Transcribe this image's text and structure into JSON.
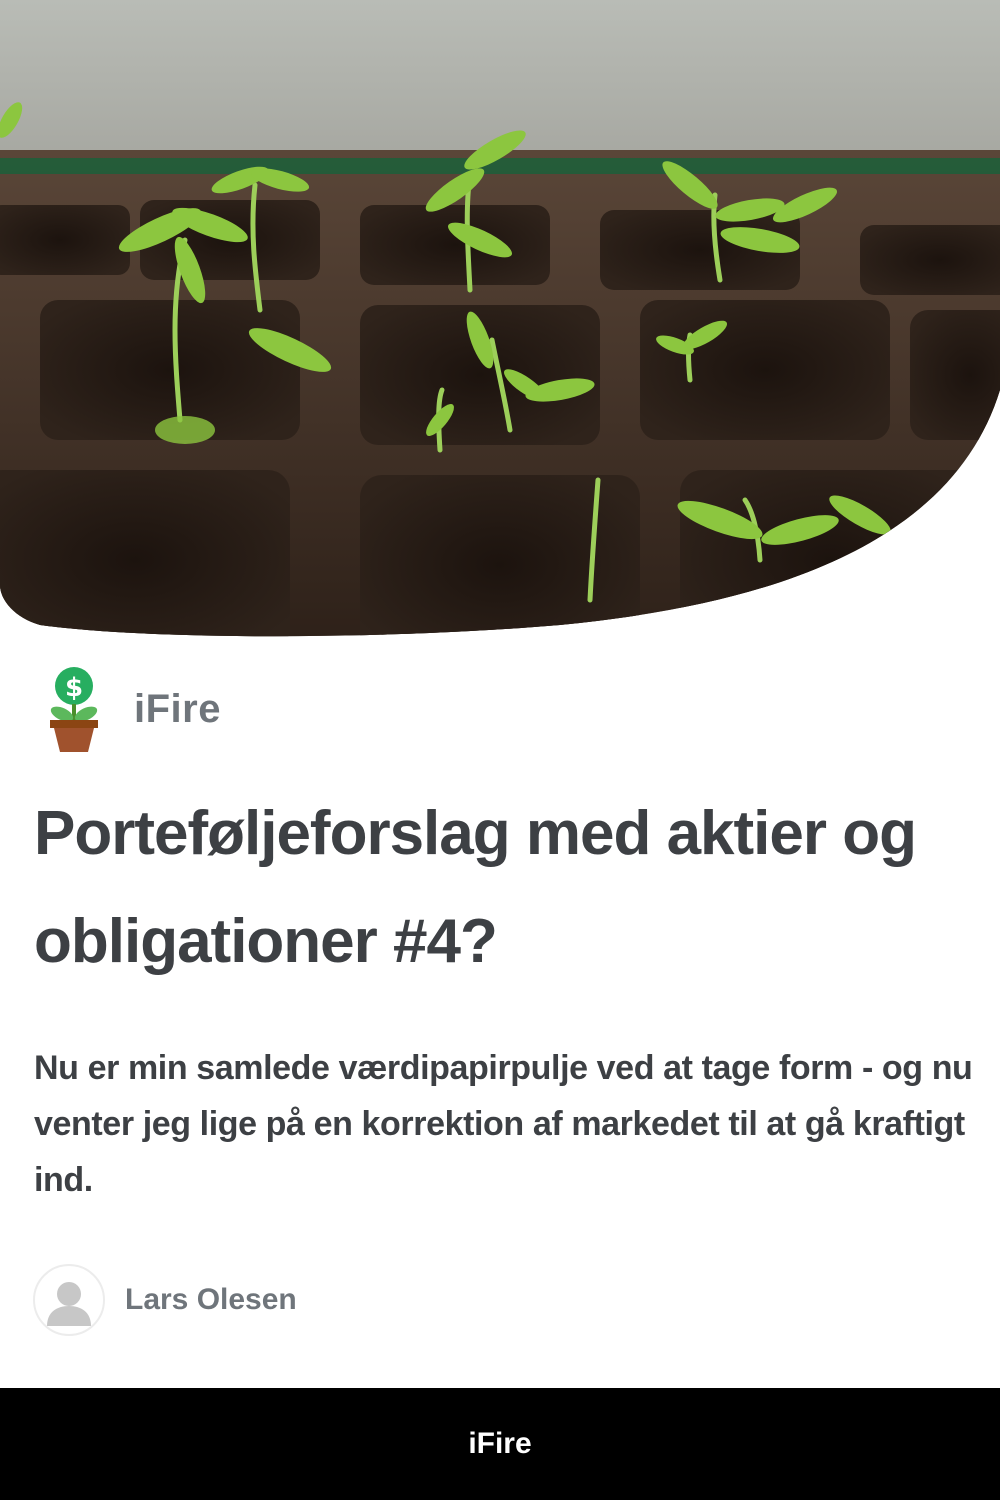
{
  "site": {
    "name": "iFire"
  },
  "hero": {
    "image_subject": "seedlings sprouting in a peat seed tray",
    "colors": {
      "soil": "#3a2a20",
      "leaf": "#8cc63f",
      "glass": "#1f5e3a"
    }
  },
  "logo": {
    "icon": "money-plant-icon",
    "symbol": "$",
    "colors": {
      "coin": "#27ae60",
      "leaf": "#5cb85c",
      "pot": "#a0522d"
    }
  },
  "post": {
    "title": "Porteføljeforslag med aktier og obligationer #4?",
    "excerpt": "Nu er min samlede værdipapirpulje ved at tage form - og nu venter jeg lige på en korrektion af markedet til at gå kraftigt ind.",
    "author": "Lars Olesen",
    "author_icon": "user-avatar-icon"
  },
  "footer": {
    "label": "iFire"
  },
  "colors": {
    "title_text": "#3d4044",
    "muted_text": "#6f757b",
    "footer_bg": "#000000"
  }
}
